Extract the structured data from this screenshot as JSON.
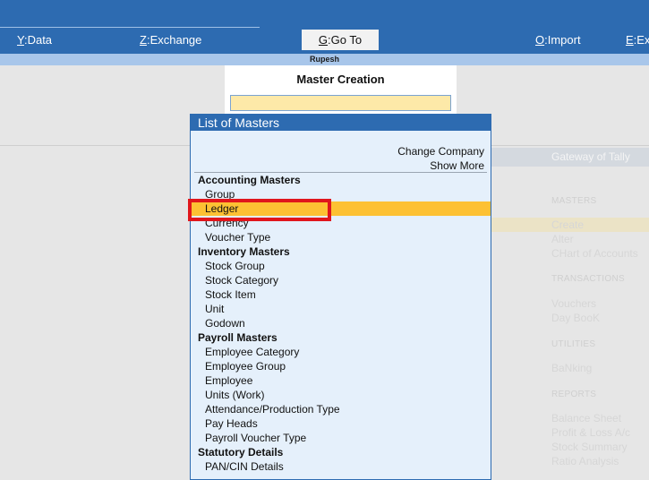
{
  "topbar": {
    "menu": [
      {
        "key": "Y",
        "rest": ":Data"
      },
      {
        "key": "Z",
        "rest": ":Exchange"
      },
      {
        "key": "G",
        "rest": ":Go To"
      },
      {
        "key": "O",
        "rest": ":Import"
      },
      {
        "key": "E",
        "rest": ":Ex"
      }
    ]
  },
  "company_name": "Rupesh",
  "master_creation": {
    "title": "Master Creation",
    "input_value": ""
  },
  "list": {
    "title": "List of Masters",
    "options": [
      "Change Company",
      "Show More"
    ],
    "groups": [
      {
        "name": "Accounting Masters",
        "items": [
          "Group",
          "Ledger",
          "Currency",
          "Voucher Type"
        ]
      },
      {
        "name": "Inventory Masters",
        "items": [
          "Stock Group",
          "Stock Category",
          "Stock Item",
          "Unit",
          "Godown"
        ]
      },
      {
        "name": "Payroll Masters",
        "items": [
          "Employee Category",
          "Employee Group",
          "Employee",
          "Units (Work)",
          "Attendance/Production Type",
          "Pay Heads",
          "Payroll Voucher Type"
        ]
      },
      {
        "name": "Statutory Details",
        "items": [
          "PAN/CIN Details"
        ]
      }
    ],
    "selected": "Ledger"
  },
  "gateway": {
    "title": "Gateway of Tally",
    "sections": [
      {
        "heading": "MASTERS",
        "items": [
          "Create",
          "Alter",
          "CHart of Accounts"
        ]
      },
      {
        "heading": "TRANSACTIONS",
        "items": [
          "Vouchers",
          "Day BooK"
        ]
      },
      {
        "heading": "UTILITIES",
        "items": [
          "BaNking"
        ]
      },
      {
        "heading": "REPORTS",
        "items": [
          "Balance Sheet",
          "Profit & Loss A/c",
          "Stock Summary",
          "Ratio Analysis"
        ]
      }
    ]
  },
  "colors": {
    "topbar": "#2d6bb1",
    "selection": "#fdc133",
    "annotation": "#e0161c"
  }
}
